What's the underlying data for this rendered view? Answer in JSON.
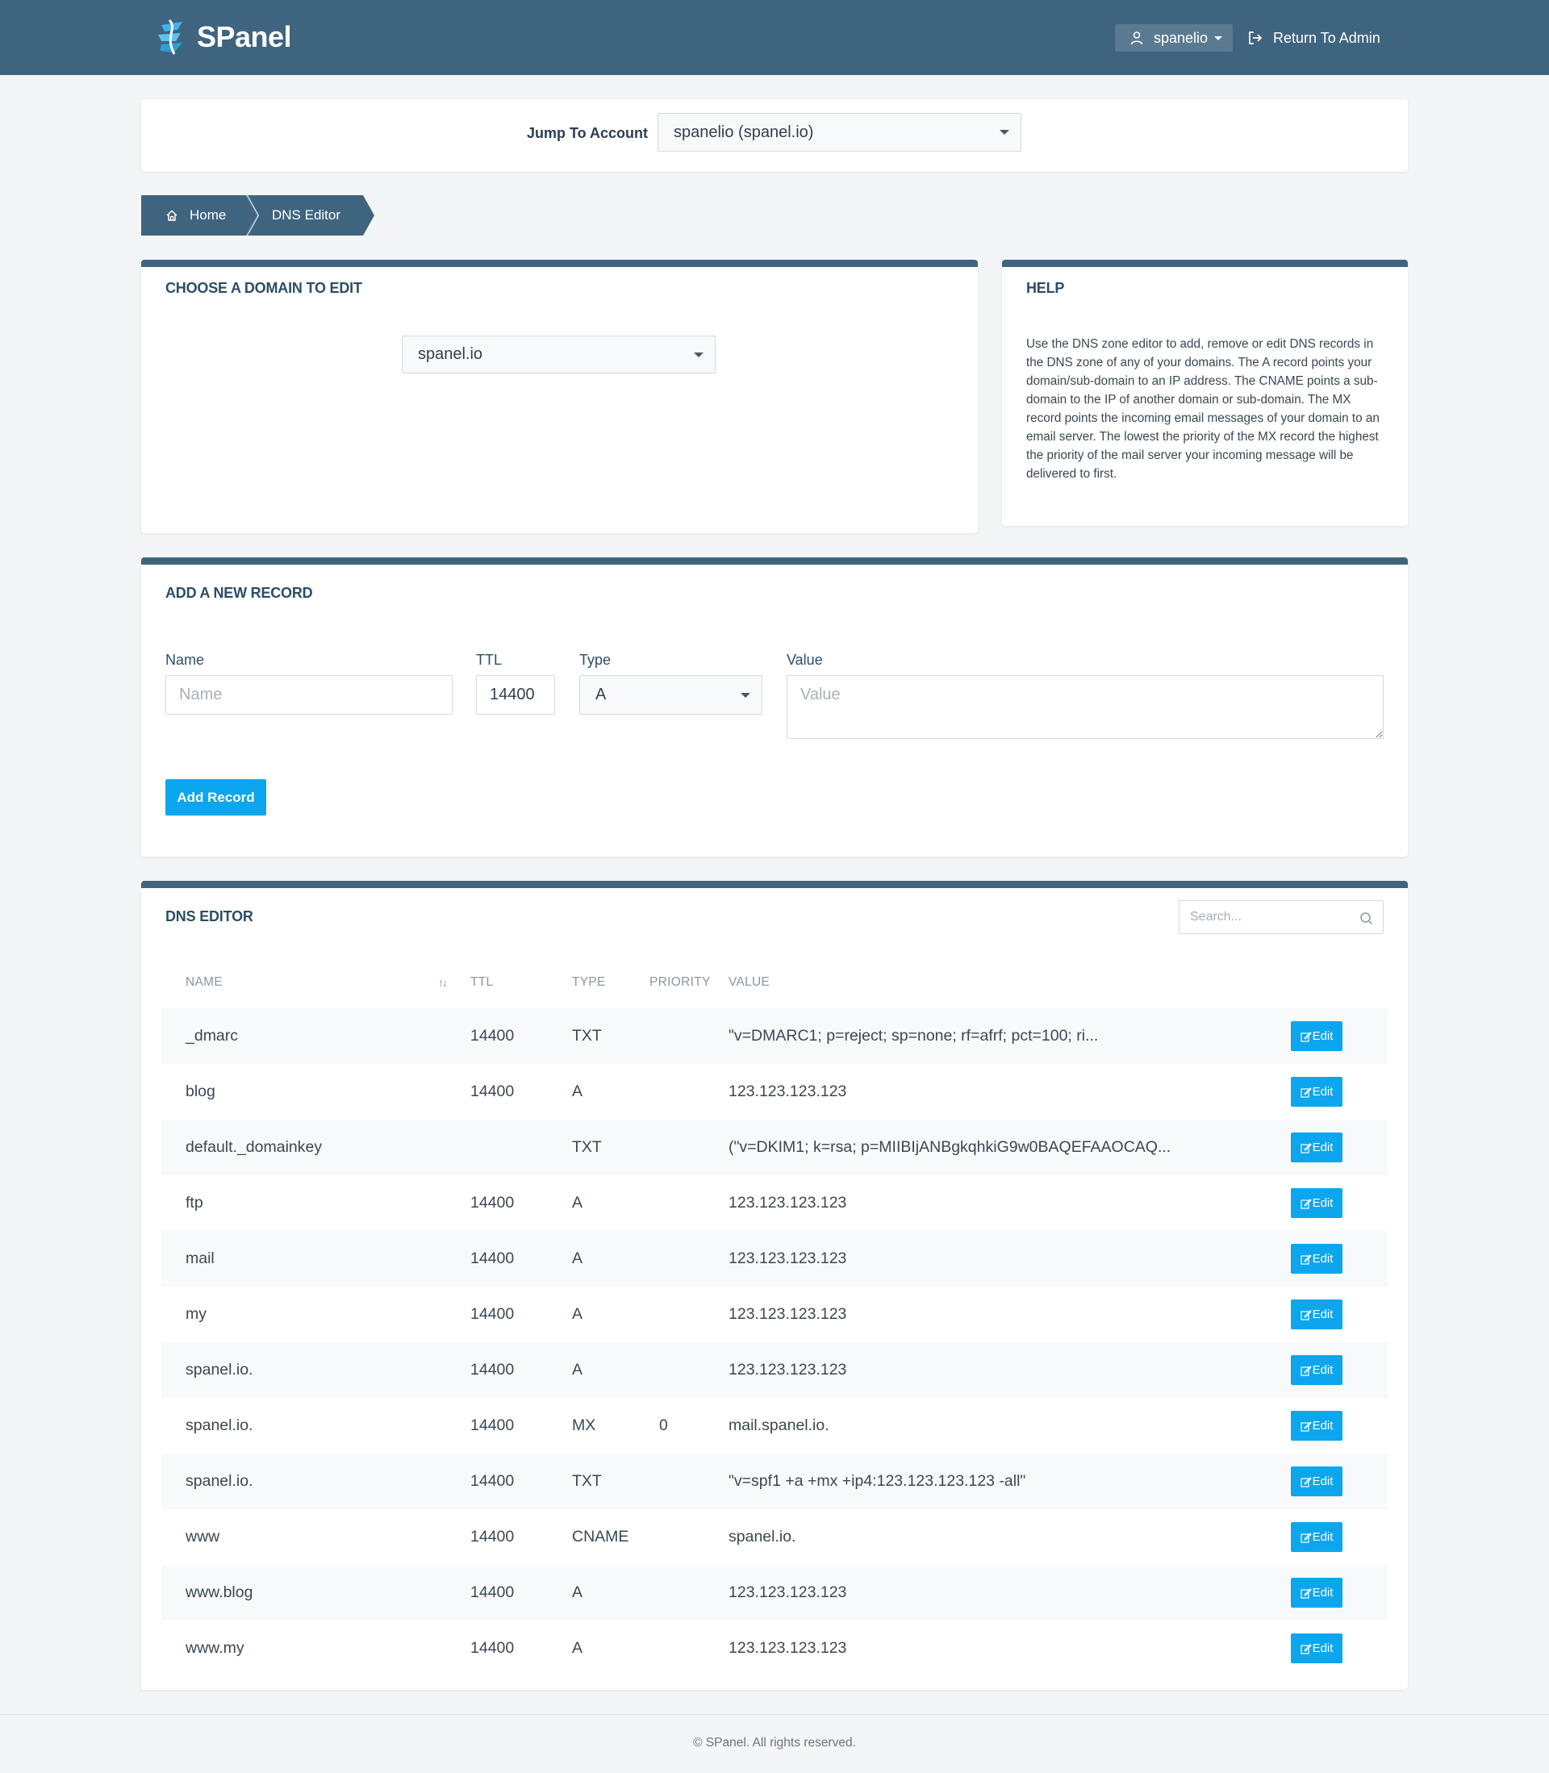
{
  "brand": {
    "name": "SPanel"
  },
  "header": {
    "user": "spanelio",
    "return_label": "Return To Admin"
  },
  "jump": {
    "label": "Jump To Account",
    "selected": "spanelio (spanel.io)"
  },
  "breadcrumb": {
    "home": "Home",
    "current": "DNS Editor"
  },
  "domain_card": {
    "title": "Choose a domain to edit",
    "selected": "spanel.io"
  },
  "help": {
    "title": "Help",
    "text": "Use the DNS zone editor to add, remove or edit DNS records in the DNS zone of any of your domains. The A record points your domain/sub-domain to an IP address. The CNAME points a sub-domain to the IP of another domain or sub-domain. The MX record points the incoming email messages of your domain to an email server. The lowest the priority of the MX record the highest the priority of the mail server your incoming message will be delivered to first."
  },
  "add_record": {
    "title": "Add a new record",
    "name_label": "Name",
    "name_placeholder": "Name",
    "ttl_label": "TTL",
    "ttl_value": "14400",
    "type_label": "Type",
    "type_value": "A",
    "value_label": "Value",
    "value_placeholder": "Value",
    "button": "Add Record"
  },
  "dns_editor": {
    "title": "DNS Editor",
    "search_placeholder": "Search...",
    "columns": [
      "Name",
      "TTL",
      "Type",
      "Priority",
      "Value"
    ],
    "sort_glyph": "↑↓",
    "edit_label": "Edit",
    "rows": [
      {
        "name": "_dmarc",
        "ttl": "14400",
        "type": "TXT",
        "priority": "",
        "value": "\"v=DMARC1; p=reject; sp=none; rf=afrf; pct=100; ri..."
      },
      {
        "name": "blog",
        "ttl": "14400",
        "type": "A",
        "priority": "",
        "value": "123.123.123.123"
      },
      {
        "name": "default._domainkey",
        "ttl": "",
        "type": "TXT",
        "priority": "",
        "value": "(\"v=DKIM1; k=rsa; p=MIIBIjANBgkqhkiG9w0BAQEFAAOCAQ..."
      },
      {
        "name": "ftp",
        "ttl": "14400",
        "type": "A",
        "priority": "",
        "value": "123.123.123.123"
      },
      {
        "name": "mail",
        "ttl": "14400",
        "type": "A",
        "priority": "",
        "value": "123.123.123.123"
      },
      {
        "name": "my",
        "ttl": "14400",
        "type": "A",
        "priority": "",
        "value": "123.123.123.123"
      },
      {
        "name": "spanel.io.",
        "ttl": "14400",
        "type": "A",
        "priority": "",
        "value": "123.123.123.123"
      },
      {
        "name": "spanel.io.",
        "ttl": "14400",
        "type": "MX",
        "priority": "0",
        "value": "mail.spanel.io."
      },
      {
        "name": "spanel.io.",
        "ttl": "14400",
        "type": "TXT",
        "priority": "",
        "value": "\"v=spf1 +a +mx +ip4:123.123.123.123 -all\""
      },
      {
        "name": "www",
        "ttl": "14400",
        "type": "CNAME",
        "priority": "",
        "value": "spanel.io."
      },
      {
        "name": "www.blog",
        "ttl": "14400",
        "type": "A",
        "priority": "",
        "value": "123.123.123.123"
      },
      {
        "name": "www.my",
        "ttl": "14400",
        "type": "A",
        "priority": "",
        "value": "123.123.123.123"
      }
    ]
  },
  "footer": {
    "text": "© SPanel. All rights reserved."
  },
  "colors": {
    "header": "#3f647f",
    "accent": "#0ca6ee",
    "row_alt": "#f8f9fa"
  }
}
